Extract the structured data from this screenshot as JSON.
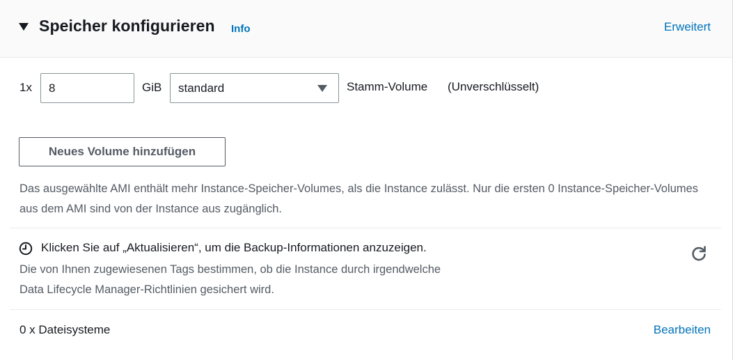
{
  "header": {
    "title": "Speicher konfigurieren",
    "info_link": "Info",
    "advanced_link": "Erweitert"
  },
  "volume": {
    "quantity": "1x",
    "size_value": "8",
    "size_unit": "GiB",
    "type_selected": "standard",
    "role": "Stamm-Volume",
    "encryption": "(Unverschlüsselt)"
  },
  "add_volume_button": "Neues Volume hinzufügen",
  "ami_note": "Das ausgewählte AMI enthält mehr Instance-Speicher-Volumes, als die Instance zulässt. Nur die ersten 0 Instance-Speicher-Volumes aus dem AMI sind von der Instance aus zugänglich.",
  "backup": {
    "message": "Klicken Sie auf „Aktualisieren“, um die Backup-Informationen anzuzeigen.",
    "description_line1": "Die von Ihnen zugewiesenen Tags bestimmen, ob die Instance durch irgendwelche",
    "description_line2": "Data Lifecycle Manager-Richtlinien gesichert wird.",
    "status_icon": "clock-icon",
    "refresh_icon": "refresh-icon"
  },
  "file_systems": {
    "label": "0 x Dateisysteme",
    "edit_link": "Bearbeiten"
  },
  "colors": {
    "link": "#0073bb",
    "text": "#16191f",
    "secondary_text": "#545b64",
    "header_bg": "#fafafa"
  }
}
